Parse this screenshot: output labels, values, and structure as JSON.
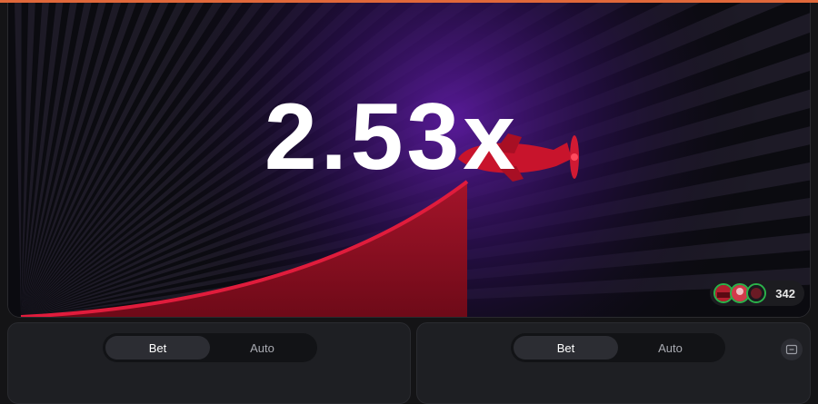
{
  "game": {
    "multiplier": "2.53x",
    "player_count": "342",
    "colors": {
      "accent_top": "#e0683a",
      "curve": "#e01c3c",
      "fill": "#8a0f1e",
      "glow": "#5b1a9e",
      "online_ring": "#2bb34a"
    },
    "icons": [
      "plane-icon",
      "avatar-icon",
      "remove-panel-icon"
    ]
  },
  "bet_panels": [
    {
      "tabs": [
        {
          "label": "Bet",
          "active": true
        },
        {
          "label": "Auto",
          "active": false
        }
      ]
    },
    {
      "tabs": [
        {
          "label": "Bet",
          "active": true
        },
        {
          "label": "Auto",
          "active": false
        }
      ]
    }
  ]
}
